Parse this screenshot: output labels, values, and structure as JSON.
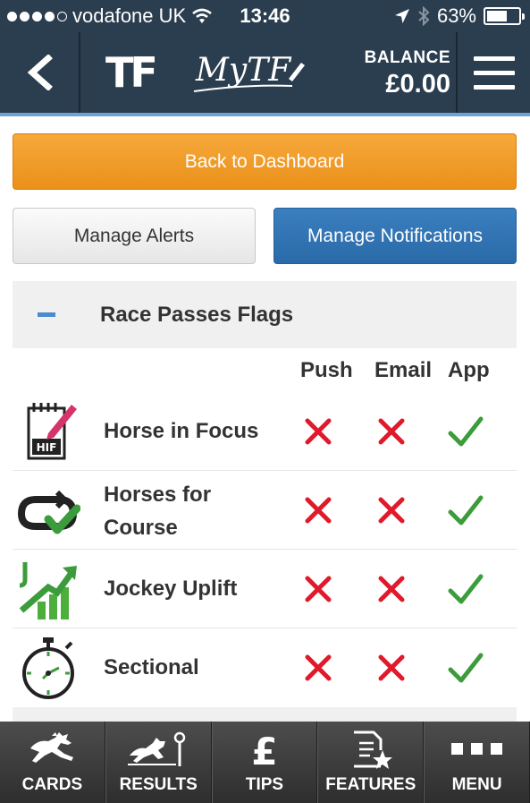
{
  "status_bar": {
    "carrier": "vodafone UK",
    "time": "13:46",
    "battery_percent": "63%",
    "battery_level": 0.63
  },
  "navbar": {
    "logo_text": "TF",
    "mytf_text": "MyTF",
    "balance_label": "BALANCE",
    "balance_value": "£0.00"
  },
  "buttons": {
    "dashboard": "Back to Dashboard",
    "alerts": "Manage Alerts",
    "notifications": "Manage Notifications"
  },
  "section": {
    "title": "Race Passes Flags",
    "columns": [
      "Push",
      "Email",
      "App"
    ],
    "rows": [
      {
        "label_lines": [
          "Horse in Focus"
        ],
        "icon": "hif-notepad-icon",
        "push": false,
        "email": false,
        "app": true
      },
      {
        "label_lines": [
          "Horses for",
          "Course"
        ],
        "icon": "course-loop-check-icon",
        "push": false,
        "email": false,
        "app": true
      },
      {
        "label_lines": [
          "Jockey Uplift"
        ],
        "icon": "jockey-uplift-chart-icon",
        "push": false,
        "email": false,
        "app": true
      },
      {
        "label_lines": [
          "Sectional"
        ],
        "icon": "stopwatch-icon",
        "push": false,
        "email": false,
        "app": true
      }
    ]
  },
  "colors": {
    "nav_bg": "#2b3e50",
    "orange": "#f0981f",
    "blue_button": "#2f72b2",
    "cross_red": "#e0192b",
    "check_green": "#3c9c3c"
  },
  "tabs": [
    {
      "label": "CARDS",
      "icon": "horse-jumping-icon"
    },
    {
      "label": "RESULTS",
      "icon": "horse-finish-post-icon"
    },
    {
      "label": "TIPS",
      "icon": "pound-icon"
    },
    {
      "label": "FEATURES",
      "icon": "features-star-icon"
    },
    {
      "label": "MENU",
      "icon": "menu-dots-icon"
    }
  ]
}
